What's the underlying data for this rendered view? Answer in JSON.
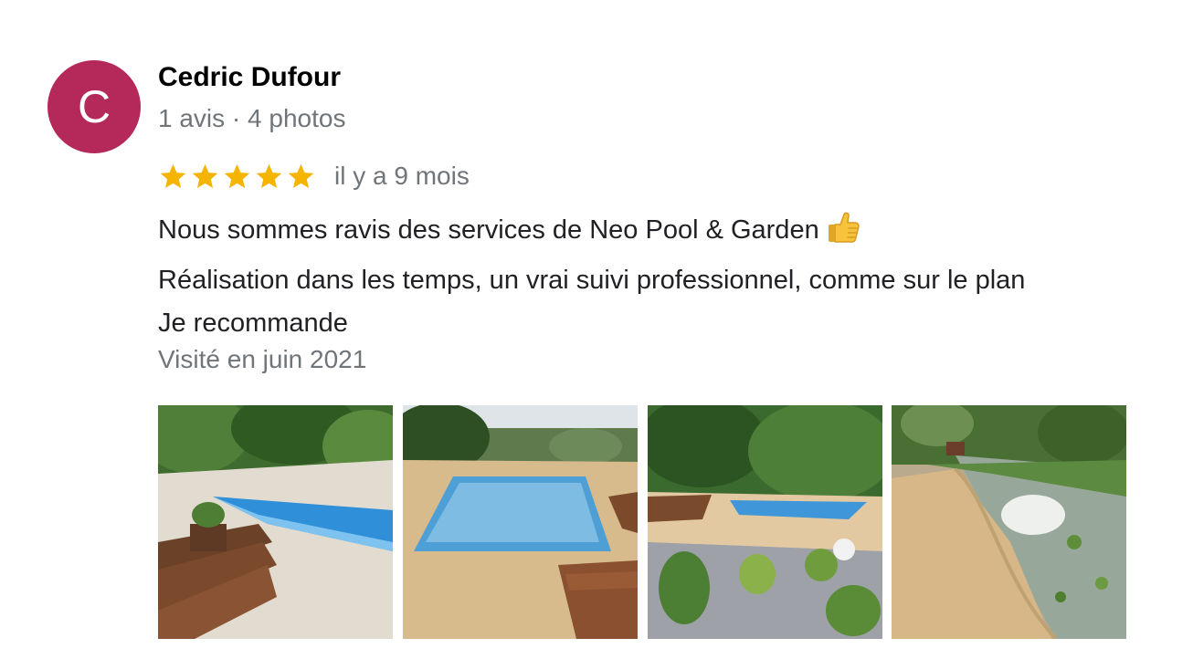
{
  "review": {
    "avatar_initial": "C",
    "author": "Cedric Dufour",
    "author_meta": "1 avis · 4 photos",
    "rating": 5,
    "rating_max": 5,
    "time_ago": "il y a 9 mois",
    "body_lines": [
      "Nous sommes ravis des services de Neo Pool & Garden",
      "Réalisation dans les temps, un vrai suivi professionnel, comme sur le plan",
      "Je recommande"
    ],
    "visited": "Visité en juin 2021",
    "photos": [
      "pool-photo",
      "pool-photo",
      "pool-photo",
      "garden-path-photo"
    ]
  },
  "colors": {
    "avatar": "#b5285a",
    "star": "#f4b400",
    "secondary_text": "#70757a",
    "primary_text": "#202124"
  },
  "icons": {
    "rating_star": "star-icon",
    "thumbs_up": "thumbs-up-icon"
  }
}
